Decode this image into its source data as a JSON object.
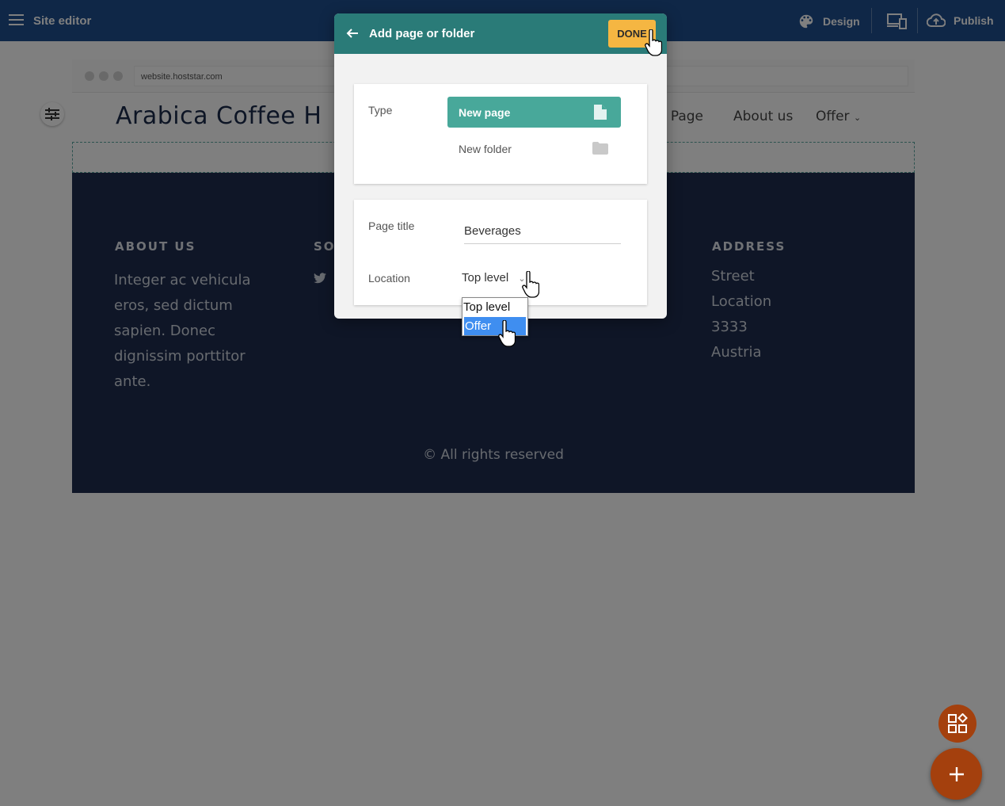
{
  "topbar": {
    "title": "Site editor",
    "design_label": "Design",
    "publish_label": "Publish"
  },
  "browser": {
    "url": "website.hoststar.com"
  },
  "site": {
    "logo_text": "Arabica Coffee H",
    "nav": [
      "e Page",
      "About us",
      "Offer"
    ],
    "footer": {
      "about_heading": "ABOUT US",
      "about_text": [
        "Integer ac vehicula",
        "eros, sed dictum",
        "sapien. Donec",
        "dignissim porttitor",
        "ante."
      ],
      "social_heading": "SO",
      "address_heading": "ADDRESS",
      "address_lines": [
        "Street",
        "Location",
        "3333",
        "Austria"
      ],
      "copyright": "© All rights reserved"
    }
  },
  "dialog": {
    "title": "Add page or folder",
    "done_label": "DONE",
    "type_label": "Type",
    "new_page_label": "New page",
    "new_folder_label": "New folder",
    "page_title_label": "Page title",
    "page_title_value": "Beverages",
    "location_label": "Location",
    "location_value": "Top level",
    "location_options": [
      "Top level",
      "Offer"
    ],
    "location_highlighted": "Offer"
  },
  "colors": {
    "topbar": "#1f4f8f",
    "dialog_header": "#2a7b78",
    "done_button": "#f5b642",
    "new_page_button": "#48a89a",
    "footer_bg": "#1e2d4f",
    "fab": "#a4400d"
  }
}
